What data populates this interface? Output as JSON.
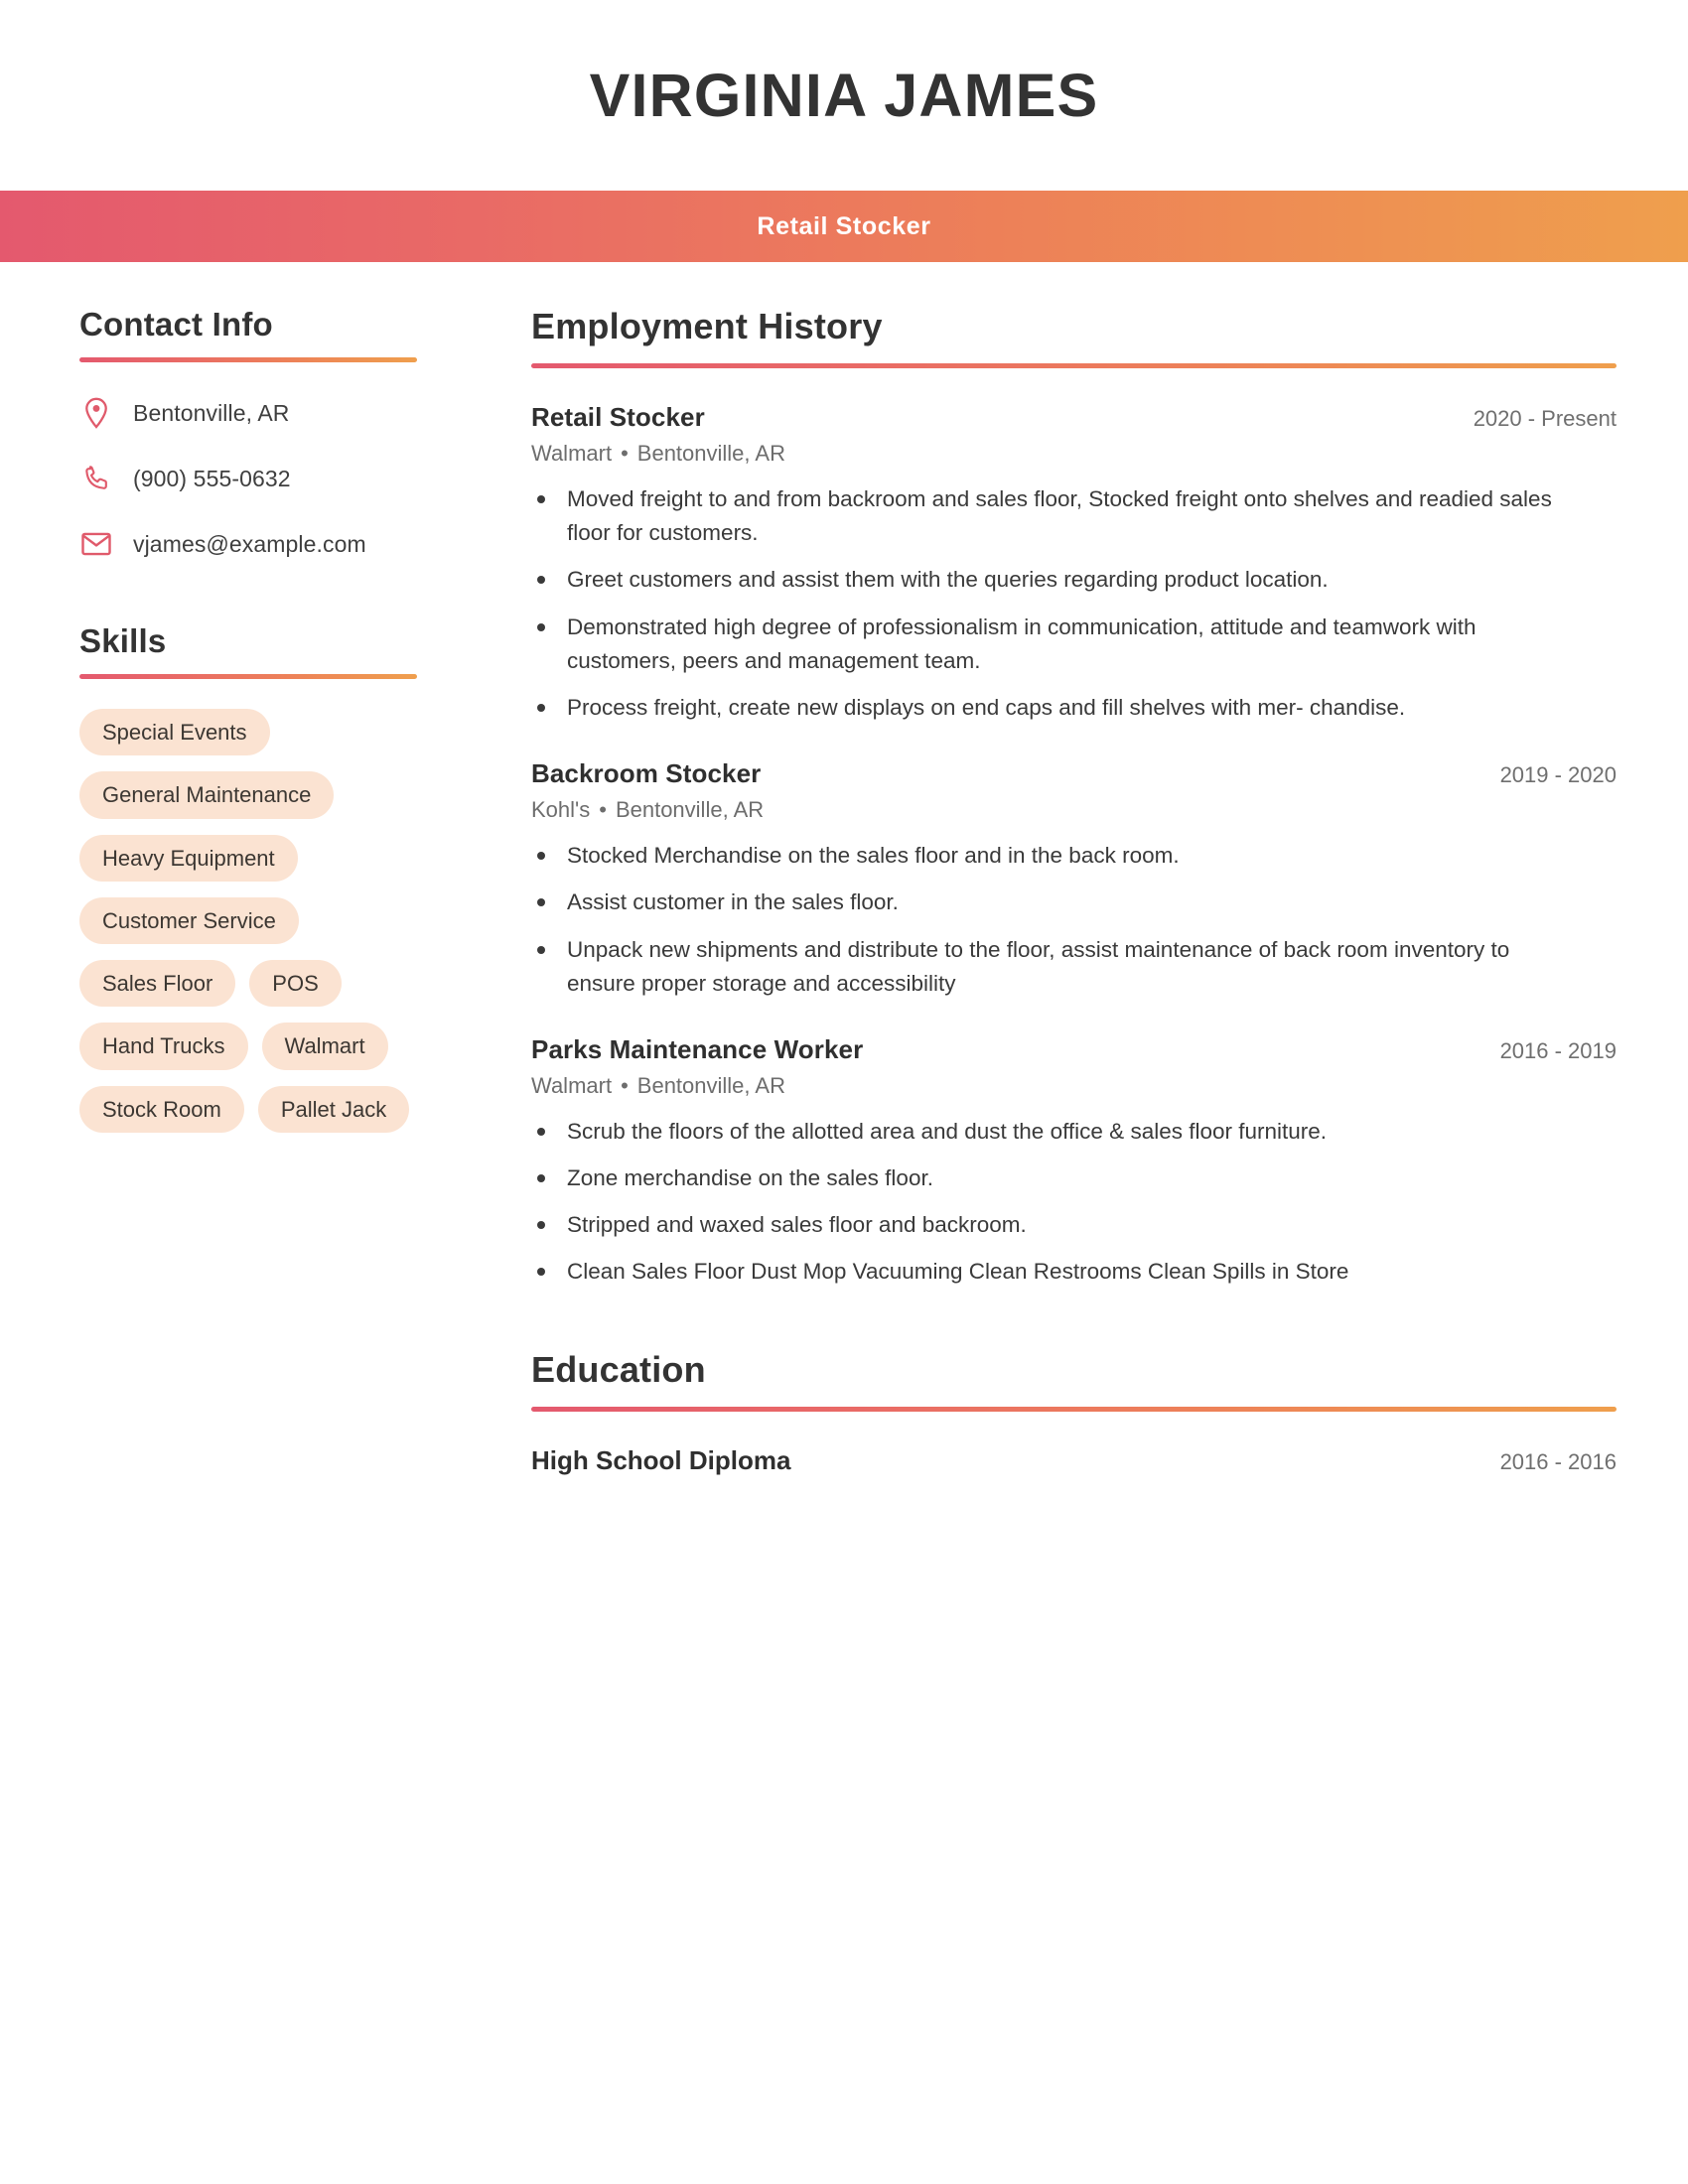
{
  "header": {
    "full_name": "VIRGINIA JAMES",
    "job_title": "Retail Stocker",
    "gradient_start": "#e4596e",
    "gradient_end": "#ef9f4d"
  },
  "sidebar": {
    "contact": {
      "heading": "Contact Info",
      "items": [
        {
          "icon": "location-pin-icon",
          "value": "Bentonville, AR"
        },
        {
          "icon": "phone-icon",
          "value": "(900) 555-0632"
        },
        {
          "icon": "envelope-icon",
          "value": "vjames@example.com"
        }
      ]
    },
    "skills": {
      "heading": "Skills",
      "tag_color": "#fbe3d2",
      "items": [
        "Special Events",
        "General Maintenance",
        "Heavy Equipment",
        "Customer Service",
        "Sales Floor",
        "POS",
        "Hand Trucks",
        "Walmart",
        "Stock Room",
        "Pallet Jack"
      ]
    }
  },
  "main": {
    "employment": {
      "heading": "Employment History",
      "jobs": [
        {
          "role": "Retail Stocker",
          "dates": "2020 - Present",
          "company": "Walmart",
          "location": "Bentonville, AR",
          "bullets": [
            "Moved freight to and from backroom and sales floor, Stocked freight onto shelves and readied sales floor for customers.",
            "Greet customers and assist them with the queries regarding product location.",
            "Demonstrated high degree of professionalism in communication, attitude and teamwork with customers, peers and management team.",
            "Process freight, create new displays on end caps and fill shelves with mer- chandise."
          ]
        },
        {
          "role": "Backroom Stocker",
          "dates": "2019 - 2020",
          "company": "Kohl's",
          "location": "Bentonville, AR",
          "bullets": [
            "Stocked Merchandise on the sales floor and in the back room.",
            "Assist customer in the sales floor.",
            "Unpack new shipments and distribute to the floor, assist maintenance of back room inventory to ensure proper storage and accessibility"
          ]
        },
        {
          "role": "Parks Maintenance Worker",
          "dates": "2016 - 2019",
          "company": "Walmart",
          "location": "Bentonville, AR",
          "bullets": [
            "Scrub the floors of the allotted area and dust the office & sales floor furniture.",
            "Zone merchandise on the sales floor.",
            "Stripped and waxed sales floor and backroom.",
            "Clean Sales Floor Dust Mop Vacuuming Clean Restrooms Clean Spills in Store"
          ]
        }
      ]
    },
    "education": {
      "heading": "Education",
      "entries": [
        {
          "degree": "High School Diploma",
          "dates": "2016 - 2016"
        }
      ]
    }
  },
  "separator_glyph": "•"
}
